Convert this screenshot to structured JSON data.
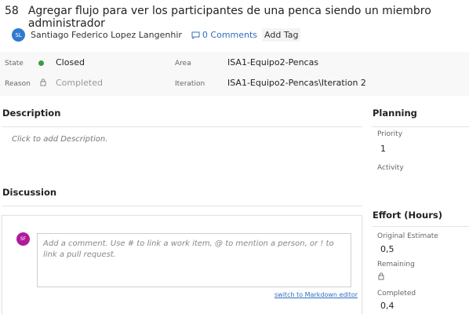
{
  "work_item": {
    "id": "58",
    "title": "Agregar flujo para ver los participantes de una penca siendo un miembro administrador"
  },
  "author": {
    "initials": "SL",
    "name": "Santiago Federico Lopez Langenhir"
  },
  "comments_link": "0 Comments",
  "add_tag_label": "Add Tag",
  "fields": {
    "state_label": "State",
    "state_value": "Closed",
    "reason_label": "Reason",
    "reason_value": "Completed",
    "area_label": "Area",
    "area_value": "ISA1-Equipo2-Pencas",
    "iteration_label": "Iteration",
    "iteration_value": "ISA1-Equipo2-Pencas\\Iteration 2"
  },
  "description": {
    "title": "Description",
    "placeholder": "Click to add Description."
  },
  "discussion": {
    "title": "Discussion",
    "avatar_initials": "SF",
    "comment_placeholder": "Add a comment. Use # to link a work item, @ to mention a person, or ! to link a pull request.",
    "markdown_link": "switch to Markdown editor"
  },
  "planning": {
    "title": "Planning",
    "priority_label": "Priority",
    "priority_value": "1",
    "activity_label": "Activity"
  },
  "effort": {
    "title": "Effort (Hours)",
    "original_label": "Original Estimate",
    "original_value": "0,5",
    "remaining_label": "Remaining",
    "completed_label": "Completed",
    "completed_value": "0,4"
  },
  "colors": {
    "closed_dot": "#3a9e3a",
    "link": "#2f6fbf"
  },
  "icons": [
    "comment-icon",
    "lock-icon",
    "padlock-icon"
  ]
}
